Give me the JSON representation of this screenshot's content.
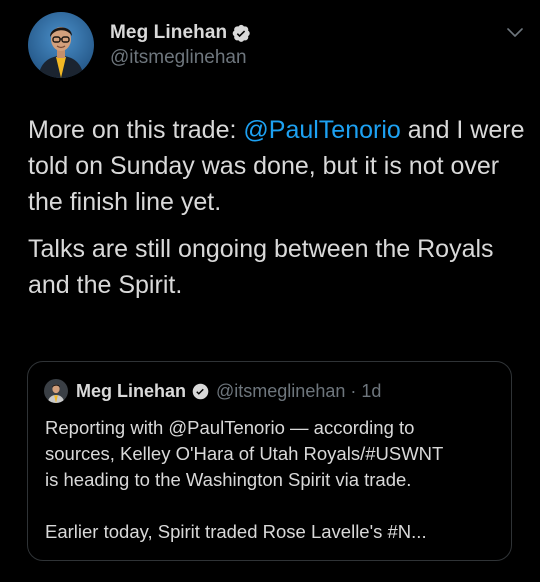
{
  "author": {
    "display_name": "Meg Linehan",
    "handle": "@itsmeglinehan",
    "verified_icon": "verified-badge-icon"
  },
  "menu": {
    "icon": "chevron-down-icon"
  },
  "tweet": {
    "p1_pre": "More on this trade: ",
    "p1_mention": "@PaulTenorio",
    "p1_post": " and I were told on Sunday was done, but it is not over the finish line yet.",
    "p2": "Talks are still ongoing between the Royals and the Spirit."
  },
  "quoted_tweet": {
    "display_name": "Meg Linehan",
    "meta": "@itsmeglinehan · 1d",
    "lines": [
      "Reporting with @PaulTenorio — according to",
      "sources, Kelley O'Hara of Utah Royals/#USWNT",
      "is heading to the Washington Spirit via trade.",
      "Earlier today, Spirit traded Rose Lavelle's #N..."
    ]
  },
  "colors": {
    "background": "#000000",
    "text": "#d9d9d9",
    "secondary_text": "#6e767d",
    "link": "#1da1f2",
    "verified": "#d9d9d9",
    "border": "#2f3336",
    "avatar_bg": "#2f6ea3"
  }
}
